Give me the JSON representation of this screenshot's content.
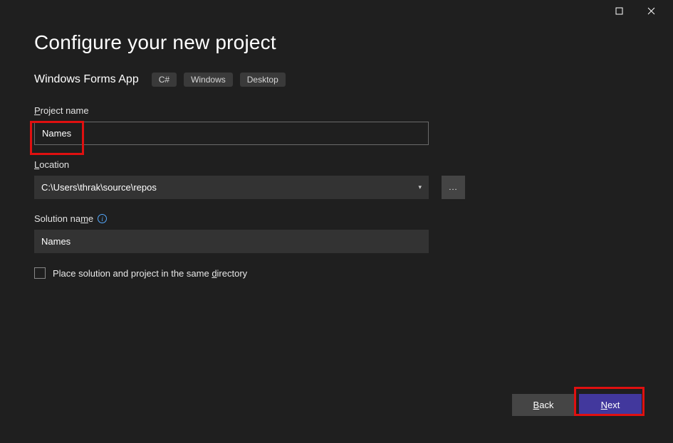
{
  "titlebar": {
    "maximize_icon": "maximize",
    "close_icon": "close"
  },
  "header": {
    "title": "Configure your new project",
    "template_name": "Windows Forms App",
    "tags": [
      "C#",
      "Windows",
      "Desktop"
    ]
  },
  "fields": {
    "project_name": {
      "label_pre": "",
      "label_u": "P",
      "label_post": "roject name",
      "value": "Names"
    },
    "location": {
      "label_pre": "",
      "label_u": "L",
      "label_post": "ocation",
      "value": "C:\\Users\\thrak\\source\\repos",
      "browse": "..."
    },
    "solution_name": {
      "label_pre": "Solution na",
      "label_u": "m",
      "label_post": "e",
      "value": "Names"
    },
    "same_dir": {
      "label_pre": "Place solution and project in the same ",
      "label_u": "d",
      "label_post": "irectory",
      "checked": false
    }
  },
  "footer": {
    "back_pre": "",
    "back_u": "B",
    "back_post": "ack",
    "next_pre": "",
    "next_u": "N",
    "next_post": "ext"
  }
}
